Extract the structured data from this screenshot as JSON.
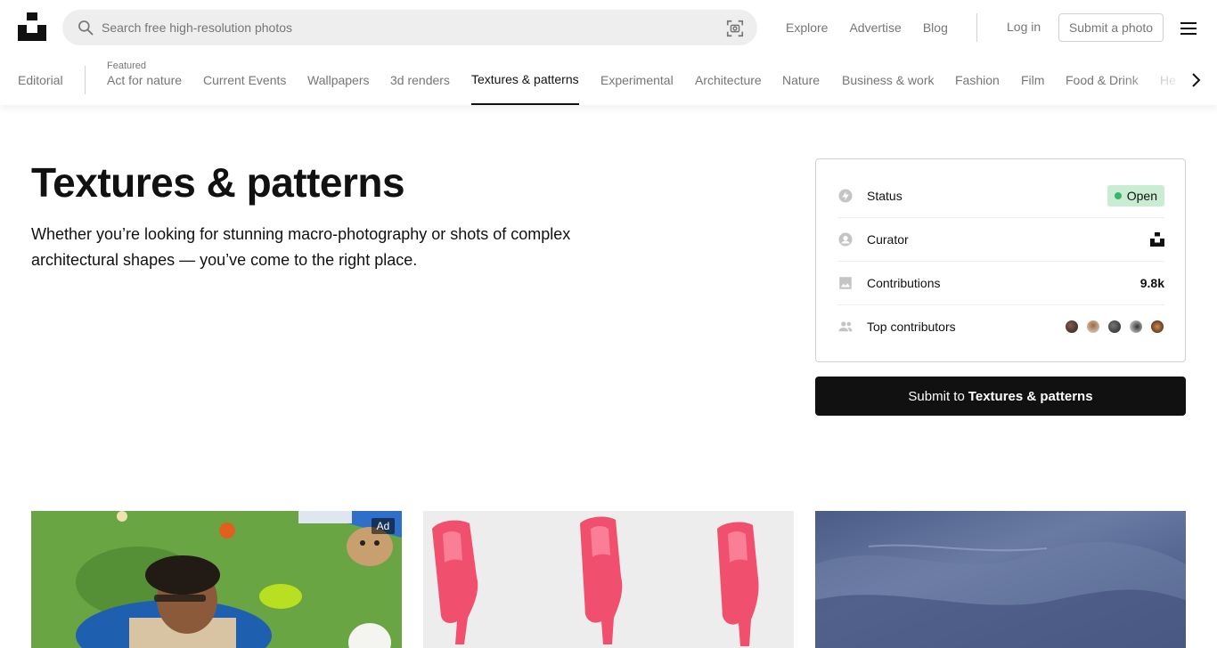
{
  "header": {
    "search_placeholder": "Search free high-resolution photos",
    "nav": [
      "Explore",
      "Advertise",
      "Blog"
    ],
    "login": "Log in",
    "submit_photo": "Submit a photo"
  },
  "categories": {
    "editorial": "Editorial",
    "featured_label": "Featured",
    "items": [
      "Act for nature",
      "Current Events",
      "Wallpapers",
      "3d renders",
      "Textures & patterns",
      "Experimental",
      "Architecture",
      "Nature",
      "Business & work",
      "Fashion",
      "Film",
      "Food & Drink",
      "He"
    ],
    "active": "Textures & patterns"
  },
  "topic": {
    "title": "Textures & patterns",
    "description": "Whether you’re looking for stunning macro-photography or shots of complex architectural shapes — you’ve come to the right place."
  },
  "info": {
    "status_label": "Status",
    "status_value": "Open",
    "curator_label": "Curator",
    "contributions_label": "Contributions",
    "contributions_value": "9.8k",
    "top_contributors_label": "Top contributors"
  },
  "submit": {
    "prefix": "Submit to",
    "topic": "Textures & patterns"
  },
  "photos": {
    "ad_label": "Ad"
  },
  "colors": {
    "status_badge_bg": "#c9ecd3",
    "status_dot": "#3cb46e",
    "button_bg": "#111111"
  },
  "icons": [
    "unsplash-logo-icon",
    "search-icon",
    "visual-search-icon",
    "menu-icon",
    "chevron-right-icon",
    "status-icon",
    "curator-icon",
    "image-icon",
    "users-icon"
  ]
}
